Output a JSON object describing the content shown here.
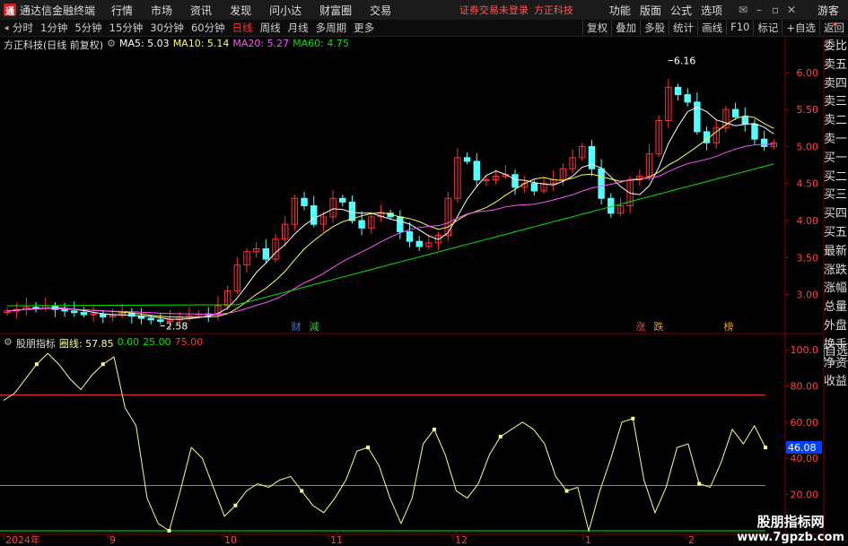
{
  "titlebar": {
    "app_title": "通达信金融终端",
    "menus": [
      "行情",
      "市场",
      "资讯",
      "发现",
      "问小达",
      "财富圈",
      "交易"
    ],
    "status_text": "证券交易未登录",
    "broker": "方正科技",
    "right_menus": [
      "功能",
      "版面",
      "公式",
      "选项"
    ],
    "user": "游客"
  },
  "toolbar": {
    "periods": [
      "分时",
      "1分钟",
      "5分钟",
      "15分钟",
      "30分钟",
      "60分钟",
      "日线",
      "周线",
      "月线",
      "多周期",
      "更多"
    ],
    "active_period": "日线",
    "right_buttons": [
      "复权",
      "叠加",
      "多股",
      "统计",
      "画线",
      "F10",
      "标记",
      "+自选",
      "返回"
    ]
  },
  "main_legend": {
    "stock": "方正科技(日线 前复权)",
    "ma5": "MA5: 5.03",
    "ma10": "MA10: 5.14",
    "ma20": "MA20: 5.27",
    "ma60": "MA60: 4.75"
  },
  "price_axis": {
    "ticks": [
      "6.00",
      "5.50",
      "5.00",
      "4.50",
      "4.00",
      "3.50",
      "3.00"
    ],
    "values": [
      6.0,
      5.5,
      5.0,
      4.5,
      4.0,
      3.5,
      3.0
    ]
  },
  "annotations": {
    "high_label": "6.16",
    "low_label": "2.58",
    "markers": [
      "财",
      "減",
      "涨",
      "跌",
      "榜"
    ]
  },
  "sub_legend": {
    "name": "股朋指标",
    "line": "圈线: 57.85",
    "v1": "0.00",
    "v2": "25.00",
    "v3": "75.00"
  },
  "sub_axis": {
    "ticks": [
      "100.0",
      "80.00",
      "60.00",
      "40.00",
      "20.00"
    ],
    "values": [
      100,
      80,
      60,
      40,
      20
    ],
    "current": "46.08",
    "current_value": 46.08
  },
  "time_axis": [
    "2024年",
    "9",
    "10",
    "11",
    "12",
    "1",
    "2"
  ],
  "right_panel": [
    "委比",
    "卖五",
    "卖四",
    "卖三",
    "卖二",
    "卖一",
    "买一",
    "买二",
    "买三",
    "买四",
    "买五",
    "最新",
    "涨跌",
    "涨幅",
    "总量",
    "外盘",
    "换手",
    "净资",
    "收益"
  ],
  "sub_tab": "自选",
  "watermark": {
    "line1": "股朋指标网",
    "line2": "www.7gpzb.com"
  },
  "colors": {
    "up": "#ff3232",
    "down": "#54ffff",
    "ma5": "#ffffff",
    "ma10": "#ffff54",
    "ma20": "#ff54ff",
    "ma60": "#00e600",
    "sub_line": "#ffff80"
  },
  "chart_data": {
    "type": "candlestick",
    "close_series": [
      2.78,
      2.8,
      2.83,
      2.82,
      2.85,
      2.8,
      2.78,
      2.76,
      2.73,
      2.74,
      2.7,
      2.72,
      2.75,
      2.71,
      2.68,
      2.66,
      2.64,
      2.66,
      2.7,
      2.72,
      2.74,
      2.73,
      2.85,
      3.05,
      3.4,
      3.58,
      3.62,
      3.48,
      3.75,
      3.95,
      4.3,
      4.2,
      3.95,
      4.05,
      4.3,
      4.25,
      4.0,
      3.9,
      4.05,
      4.1,
      4.05,
      3.85,
      3.72,
      3.65,
      3.7,
      3.8,
      4.3,
      4.85,
      4.8,
      4.55,
      4.55,
      4.6,
      4.62,
      4.45,
      4.5,
      4.4,
      4.5,
      4.55,
      4.7,
      4.85,
      5.0,
      4.7,
      4.3,
      4.1,
      4.2,
      4.55,
      4.6,
      4.9,
      5.35,
      5.8,
      5.7,
      5.6,
      5.2,
      5.05,
      5.25,
      5.5,
      5.4,
      5.3,
      5.1,
      5.0,
      5.05
    ],
    "ma60_series_endpoints": [
      2.85,
      4.75
    ],
    "sub_line_values": [
      72,
      76,
      84,
      92,
      98,
      92,
      84,
      78,
      86,
      92,
      96,
      68,
      58,
      18,
      4,
      0,
      22,
      46,
      40,
      24,
      8,
      14,
      22,
      26,
      24,
      28,
      30,
      22,
      14,
      10,
      18,
      28,
      44,
      46,
      36,
      18,
      4,
      18,
      48,
      56,
      42,
      22,
      18,
      26,
      42,
      52,
      56,
      60,
      56,
      48,
      30,
      22,
      24,
      0,
      22,
      40,
      60,
      62,
      28,
      10,
      24,
      46,
      48,
      26,
      24,
      38,
      56,
      48,
      58,
      46
    ],
    "sub_ref_lines": [
      0,
      25,
      75
    ],
    "price_range": [
      2.5,
      6.3
    ],
    "sub_range": [
      0,
      105
    ]
  }
}
